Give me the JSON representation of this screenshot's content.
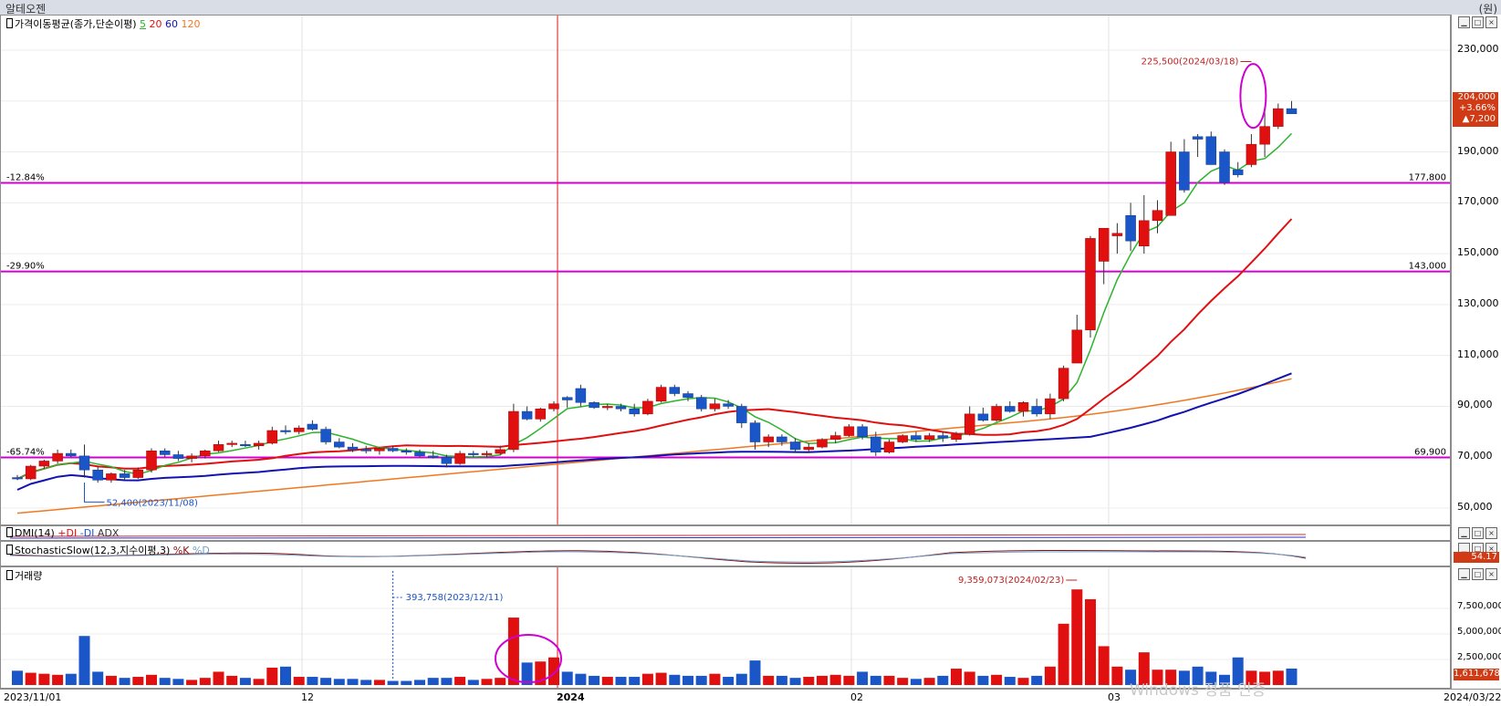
{
  "window": {
    "title": "알테오젠",
    "unit": "(원)"
  },
  "panes": {
    "price": {
      "label_prefix": "가격이동평균(종가,단순이평)",
      "ma5": "5",
      "ma20": "20",
      "ma60": "60",
      "ma120": "120"
    },
    "dmi": {
      "label_prefix": "DMI(14)",
      "pdi": "+DI",
      "mdi": "-DI",
      "adx": "ADX"
    },
    "stoch": {
      "label_prefix": "StochasticSlow(12,3,지수이평,3)",
      "k": "%K",
      "d": "%D",
      "value": "54.17"
    },
    "volume": {
      "label_prefix": "거래량",
      "value": "1,611,678"
    }
  },
  "colors": {
    "up": "#e01010",
    "down": "#1a56c8",
    "ma5": "#2db32d",
    "ma20": "#e01010",
    "ma60": "#1212b0",
    "ma120": "#f07820",
    "hline": "#d000d0",
    "circle": "#d000d0"
  },
  "price_box": {
    "close": "204,000",
    "pct": "+3.66%",
    "chg": "▲7,200"
  },
  "y_ticks": [
    "230,000",
    "210,000",
    "190,000",
    "170,000",
    "150,000",
    "130,000",
    "110,000",
    "90,000",
    "70,000",
    "50,000"
  ],
  "vol_ticks": [
    "7,500,000",
    "5,000,000",
    "2,500,000"
  ],
  "x_ticks": {
    "start": "2023/11/01",
    "m12": "12",
    "y2024": "2024",
    "m02": "02",
    "m03": "03",
    "end": "2024/03/22"
  },
  "watermark": "Windows 정품 인증",
  "chart_data": {
    "type": "candlestick",
    "title": "알테오젠",
    "x": [
      "2023/11/01",
      "2023/11/02",
      "2023/11/03",
      "2023/11/06",
      "2023/11/07",
      "2023/11/08",
      "2023/11/09",
      "2023/11/10",
      "2023/11/13",
      "2023/11/14",
      "2023/11/15",
      "2023/11/16",
      "2023/11/17",
      "2023/11/20",
      "2023/11/21",
      "2023/11/22",
      "2023/11/23",
      "2023/11/24",
      "2023/11/27",
      "2023/11/28",
      "2023/11/29",
      "2023/11/30",
      "2023/12/01",
      "2023/12/04",
      "2023/12/05",
      "2023/12/06",
      "2023/12/07",
      "2023/12/08",
      "2023/12/11",
      "2023/12/12",
      "2023/12/13",
      "2023/12/14",
      "2023/12/15",
      "2023/12/18",
      "2023/12/19",
      "2023/12/20",
      "2023/12/21",
      "2023/12/22",
      "2023/12/26",
      "2023/12/27",
      "2023/12/28",
      "2024/01/02",
      "2024/01/03",
      "2024/01/04",
      "2024/01/05",
      "2024/01/08",
      "2024/01/09",
      "2024/01/10",
      "2024/01/11",
      "2024/01/12",
      "2024/01/15",
      "2024/01/16",
      "2024/01/17",
      "2024/01/18",
      "2024/01/19",
      "2024/01/22",
      "2024/01/23",
      "2024/01/24",
      "2024/01/25",
      "2024/01/26",
      "2024/01/29",
      "2024/01/30",
      "2024/01/31",
      "2024/02/01",
      "2024/02/02",
      "2024/02/05",
      "2024/02/06",
      "2024/02/07",
      "2024/02/08",
      "2024/02/13",
      "2024/02/14",
      "2024/02/15",
      "2024/02/16",
      "2024/02/19",
      "2024/02/20",
      "2024/02/21",
      "2024/02/22",
      "2024/02/23",
      "2024/02/26",
      "2024/02/27",
      "2024/02/28",
      "2024/02/29",
      "2024/03/04",
      "2024/03/05",
      "2024/03/06",
      "2024/03/07",
      "2024/03/08",
      "2024/03/11",
      "2024/03/12",
      "2024/03/13",
      "2024/03/14",
      "2024/03/15",
      "2024/03/18",
      "2024/03/19",
      "2024/03/20",
      "2024/03/21",
      "2024/03/22"
    ],
    "ohlc": [
      [
        62000,
        63000,
        61000,
        61500
      ],
      [
        61500,
        67000,
        61000,
        66500
      ],
      [
        66500,
        69000,
        65500,
        68500
      ],
      [
        68500,
        73000,
        67500,
        71500
      ],
      [
        71500,
        73000,
        70000,
        70500
      ],
      [
        70500,
        75000,
        62000,
        65000
      ],
      [
        65000,
        66500,
        60000,
        61000
      ],
      [
        61000,
        64000,
        60000,
        63500
      ],
      [
        63500,
        65000,
        61000,
        62000
      ],
      [
        62000,
        66000,
        61500,
        65000
      ],
      [
        65000,
        73500,
        64000,
        72500
      ],
      [
        72500,
        73500,
        70000,
        71000
      ],
      [
        71000,
        72500,
        68500,
        69500
      ],
      [
        69500,
        71500,
        68000,
        70500
      ],
      [
        70500,
        73000,
        69500,
        72500
      ],
      [
        72500,
        76500,
        72000,
        75000
      ],
      [
        75000,
        76500,
        74000,
        75500
      ],
      [
        75000,
        76500,
        74000,
        74500
      ],
      [
        74500,
        76500,
        73000,
        75500
      ],
      [
        75500,
        82000,
        75000,
        80500
      ],
      [
        80500,
        82500,
        79000,
        80000
      ],
      [
        80000,
        82500,
        79000,
        81500
      ],
      [
        83000,
        84500,
        80500,
        81000
      ],
      [
        81000,
        82000,
        75000,
        76000
      ],
      [
        76000,
        77500,
        73500,
        74000
      ],
      [
        74000,
        75500,
        72000,
        73000
      ],
      [
        73000,
        74500,
        71500,
        72500
      ],
      [
        72500,
        74000,
        71000,
        73500
      ],
      [
        73500,
        74500,
        72000,
        72500
      ],
      [
        72500,
        73500,
        71000,
        72000
      ],
      [
        72000,
        73000,
        70000,
        70500
      ],
      [
        70500,
        72500,
        69500,
        70000
      ],
      [
        70000,
        71000,
        66000,
        67500
      ],
      [
        67500,
        72500,
        67000,
        71500
      ],
      [
        71500,
        72500,
        70000,
        71000
      ],
      [
        71000,
        72500,
        70000,
        71500
      ],
      [
        71500,
        74500,
        71000,
        73000
      ],
      [
        73000,
        91000,
        72000,
        88000
      ],
      [
        88000,
        90000,
        84500,
        85000
      ],
      [
        85000,
        89500,
        84000,
        89000
      ],
      [
        89000,
        92000,
        88000,
        91000
      ],
      [
        93500,
        94000,
        89500,
        92500
      ],
      [
        97000,
        98500,
        90000,
        91500
      ],
      [
        91500,
        92000,
        89000,
        89500
      ],
      [
        89500,
        91000,
        88500,
        90000
      ],
      [
        90000,
        91000,
        88000,
        89000
      ],
      [
        89000,
        91000,
        86000,
        87000
      ],
      [
        87000,
        93000,
        86500,
        92000
      ],
      [
        92000,
        98500,
        91500,
        97500
      ],
      [
        97500,
        98500,
        94000,
        95000
      ],
      [
        95000,
        96000,
        92000,
        93500
      ],
      [
        93500,
        94500,
        88000,
        89000
      ],
      [
        89000,
        93000,
        88000,
        91000
      ],
      [
        91000,
        92500,
        89000,
        90000
      ],
      [
        90000,
        91000,
        81500,
        83500
      ],
      [
        83500,
        84500,
        73000,
        76000
      ],
      [
        76000,
        79000,
        74000,
        78000
      ],
      [
        78000,
        79000,
        74500,
        76000
      ],
      [
        76000,
        77500,
        72000,
        73000
      ],
      [
        73000,
        75500,
        72000,
        74000
      ],
      [
        74000,
        77500,
        73500,
        77000
      ],
      [
        77000,
        80000,
        75500,
        78500
      ],
      [
        78500,
        83000,
        78000,
        82000
      ],
      [
        82000,
        83000,
        77000,
        78000
      ],
      [
        78000,
        80000,
        70500,
        72000
      ],
      [
        72000,
        77000,
        71500,
        76000
      ],
      [
        76000,
        79000,
        75500,
        78500
      ],
      [
        78500,
        80000,
        76000,
        77000
      ],
      [
        77000,
        79500,
        76000,
        78500
      ],
      [
        78500,
        80000,
        76000,
        77500
      ],
      [
        77000,
        80000,
        76000,
        79000
      ],
      [
        79000,
        90000,
        78500,
        87000
      ],
      [
        87000,
        89500,
        84000,
        84500
      ],
      [
        84500,
        91000,
        84000,
        90000
      ],
      [
        90000,
        92000,
        87500,
        88000
      ],
      [
        88000,
        92000,
        86000,
        91500
      ],
      [
        90000,
        93000,
        86000,
        87000
      ],
      [
        87000,
        95000,
        85000,
        93000
      ],
      [
        93000,
        106000,
        92000,
        105000
      ],
      [
        107000,
        126000,
        107000,
        120000
      ],
      [
        120000,
        157000,
        117000,
        156000
      ],
      [
        147000,
        159000,
        138000,
        160000
      ],
      [
        157000,
        162000,
        150000,
        158000
      ],
      [
        165000,
        170000,
        151000,
        155000
      ],
      [
        153000,
        173000,
        150000,
        163000
      ],
      [
        163000,
        171000,
        158000,
        167000
      ],
      [
        165000,
        194000,
        165000,
        190000
      ],
      [
        190000,
        195000,
        174000,
        175000
      ],
      [
        196000,
        197000,
        188000,
        195000
      ],
      [
        196000,
        198000,
        185000,
        185000
      ],
      [
        190000,
        191000,
        177000,
        178000
      ],
      [
        183000,
        186000,
        180000,
        181000
      ],
      [
        185000,
        197000,
        184000,
        193000
      ],
      [
        193000,
        206000,
        188000,
        200000
      ],
      [
        200000,
        209000,
        199000,
        207000
      ],
      [
        207000,
        210000,
        205000,
        205000
      ]
    ],
    "series": [
      {
        "name": "5",
        "values": []
      },
      {
        "name": "20",
        "values": []
      },
      {
        "name": "60",
        "values": []
      },
      {
        "name": "120",
        "values": []
      }
    ],
    "ylim": [
      45000,
      235000
    ],
    "ylabel": "(원)",
    "annotations": [
      {
        "text": "225,500(2024/03/18)",
        "x": "2024/03/18",
        "y": 225500
      },
      {
        "text": "52,400(2023/11/08)",
        "x": "2023/11/08",
        "y": 52400
      },
      {
        "text": "-12.84%",
        "y": 177800
      },
      {
        "text": "177,800",
        "y": 177800
      },
      {
        "text": "-29.90%",
        "y": 143000
      },
      {
        "text": "143,000",
        "y": 143000
      },
      {
        "text": "-65.74%",
        "y": 69900
      },
      {
        "text": "69,900",
        "y": 69900
      }
    ],
    "volume": {
      "values": [
        1400000,
        1200000,
        1100000,
        1000000,
        1100000,
        4800000,
        1300000,
        900000,
        700000,
        800000,
        1000000,
        700000,
        600000,
        500000,
        700000,
        1300000,
        900000,
        700000,
        600000,
        1700000,
        1800000,
        800000,
        800000,
        700000,
        600000,
        600000,
        500000,
        500000,
        400000,
        400000,
        500000,
        700000,
        700000,
        800000,
        500000,
        600000,
        700000,
        6600000,
        2200000,
        2300000,
        2700000,
        1300000,
        1100000,
        900000,
        800000,
        800000,
        800000,
        1100000,
        1200000,
        1000000,
        900000,
        900000,
        1100000,
        800000,
        1100000,
        2400000,
        900000,
        900000,
        700000,
        800000,
        900000,
        1000000,
        900000,
        1300000,
        900000,
        900000,
        700000,
        600000,
        700000,
        900000,
        1600000,
        1300000,
        900000,
        1000000,
        800000,
        700000,
        900000,
        1800000,
        6000000,
        9359073,
        8400000,
        3800000,
        1800000,
        1500000,
        3200000,
        1500000,
        1500000,
        1400000,
        1800000,
        1300000,
        1000000,
        2700000,
        1400000,
        1300000,
        1400000,
        1611678
      ],
      "annotations": [
        {
          "text": "393,758(2023/12/11)",
          "x": "2023/12/11",
          "y": 393758
        },
        {
          "text": "9,359,073(2024/02/23)",
          "x": "2024/02/23",
          "y": 9359073
        }
      ]
    },
    "stochastic": {
      "last": 54.17
    }
  }
}
